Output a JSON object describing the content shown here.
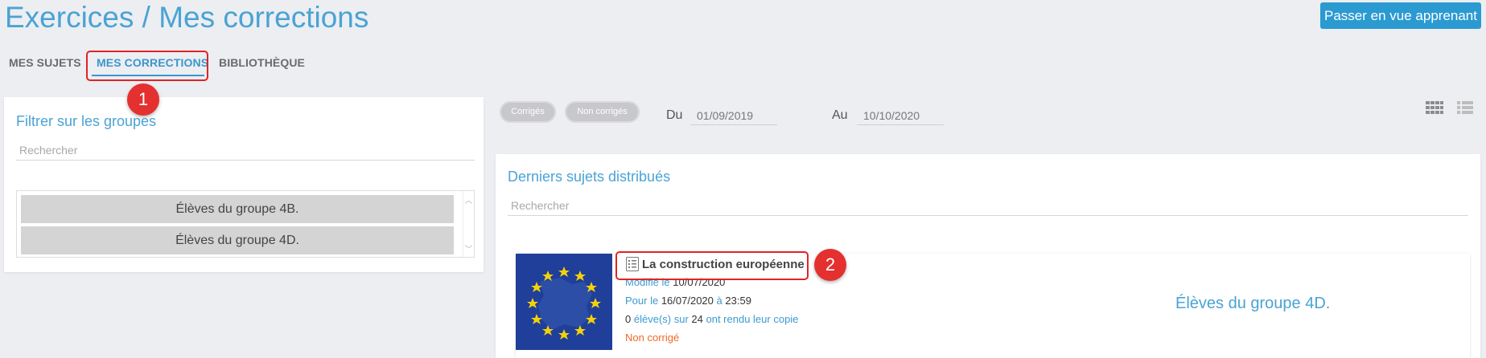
{
  "header": {
    "title": "Exercices / Mes corrections",
    "learner_button": "Passer en vue apprenant"
  },
  "tabs": [
    {
      "label": "MES SUJETS",
      "active": false
    },
    {
      "label": "MES CORRECTIONS",
      "active": true
    },
    {
      "label": "BIBLIOTHÈQUE",
      "active": false
    }
  ],
  "annotations": {
    "badge1": "1",
    "badge2": "2"
  },
  "filter_panel": {
    "title": "Filtrer sur les groupes",
    "search_placeholder": "Rechercher",
    "groups": [
      "Élèves du groupe 4B.",
      "Élèves du groupe 4D."
    ]
  },
  "filters": {
    "corrected_label": "Corrigés",
    "uncorrected_label": "Non corrigés",
    "from_label": "Du",
    "from_value": "01/09/2019",
    "to_label": "Au",
    "to_value": "10/10/2020"
  },
  "view_icons": [
    "grid-view-icon",
    "list-view-icon"
  ],
  "subjects_panel": {
    "title": "Derniers sujets distribués",
    "search_placeholder": "Rechercher",
    "card": {
      "title": "La construction européenne",
      "modified_label": "Modifié le",
      "modified_date": "10/07/2020",
      "due_label": "Pour le",
      "due_date": "16/07/2020",
      "at_label": "à",
      "due_time": "23:59",
      "submitted_count": "0",
      "students_label": "élève(s) sur",
      "total_count": "24",
      "submitted_label": "ont rendu leur copie",
      "status": "Non corrigé",
      "group": "Élèves du groupe 4D."
    }
  },
  "colors": {
    "accent": "#4aa3d4",
    "button": "#2b9ad1",
    "annotation_red": "#e53030",
    "status_orange": "#ef6a2a",
    "flag_blue": "#1f3f9a",
    "flag_star": "#f4d10a"
  }
}
